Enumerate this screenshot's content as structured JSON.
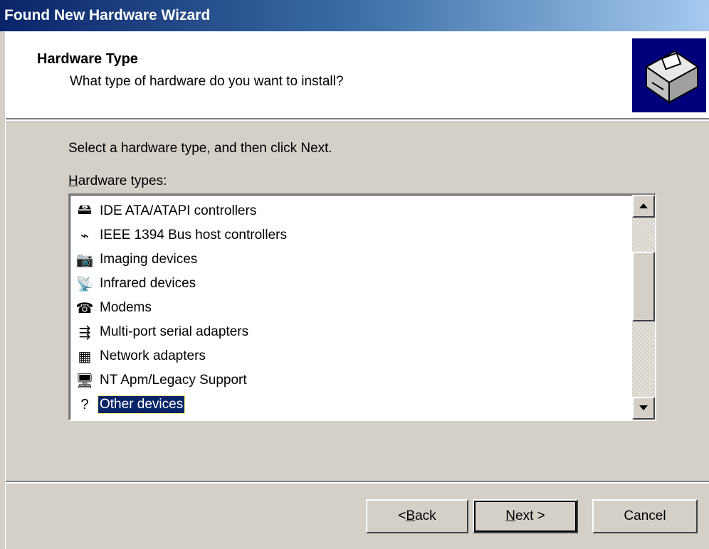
{
  "window": {
    "title": "Found New Hardware Wizard"
  },
  "header": {
    "title": "Hardware Type",
    "subtitle": "What type of hardware do you want to install?",
    "icon": "hardware-wizard-icon"
  },
  "body": {
    "instruction": "Select a hardware type, and then click Next.",
    "list_label_accel": "H",
    "list_label_rest": "ardware types:"
  },
  "list": {
    "items": [
      {
        "label": "IDE ATA/ATAPI controllers",
        "icon": "ide-controller-icon",
        "glyph": "🖴",
        "selected": false
      },
      {
        "label": "IEEE 1394 Bus host controllers",
        "icon": "ieee1394-icon",
        "glyph": "⌁",
        "selected": false
      },
      {
        "label": "Imaging devices",
        "icon": "imaging-device-icon",
        "glyph": "📷",
        "selected": false
      },
      {
        "label": "Infrared devices",
        "icon": "infrared-icon",
        "glyph": "📡",
        "selected": false
      },
      {
        "label": "Modems",
        "icon": "modem-icon",
        "glyph": "☎",
        "selected": false
      },
      {
        "label": "Multi-port serial adapters",
        "icon": "serial-adapter-icon",
        "glyph": "⇶",
        "selected": false
      },
      {
        "label": "Network adapters",
        "icon": "network-adapter-icon",
        "glyph": "▦",
        "selected": false
      },
      {
        "label": "NT Apm/Legacy Support",
        "icon": "apm-legacy-icon",
        "glyph": "🖥",
        "selected": false
      },
      {
        "label": "Other devices",
        "icon": "other-devices-icon",
        "glyph": "?",
        "selected": true
      }
    ]
  },
  "buttons": {
    "back_prefix": "< ",
    "back_accel": "B",
    "back_rest": "ack",
    "next_accel": "N",
    "next_rest": "ext >",
    "cancel": "Cancel"
  }
}
